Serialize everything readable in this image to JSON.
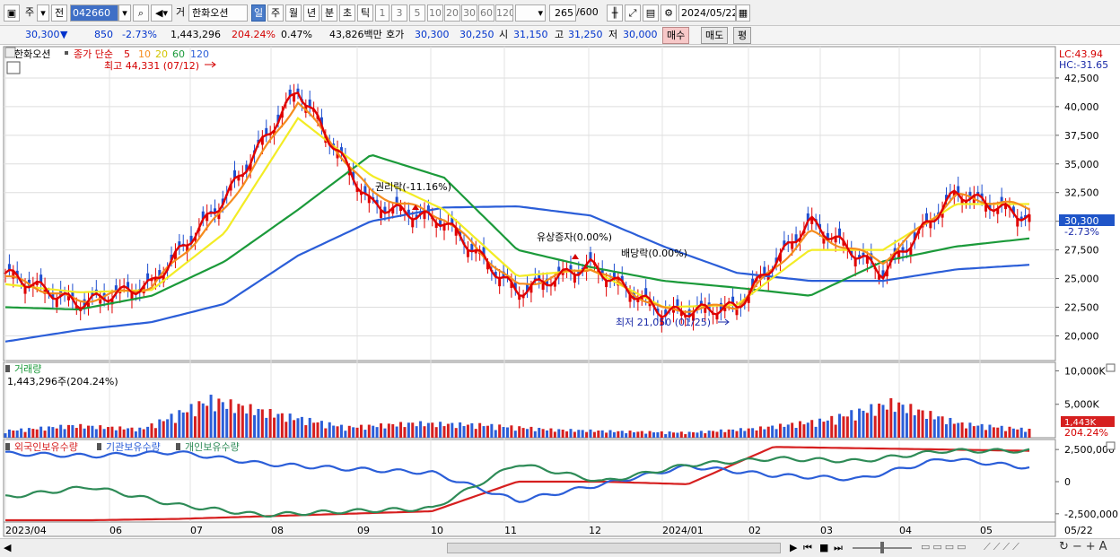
{
  "toolbar": {
    "market_label": "주",
    "prev_label": "전",
    "stock_code": "042660",
    "stock_name_prefix": "거",
    "stock_name": "한화오션",
    "period_tabs": [
      "일",
      "주",
      "월",
      "년",
      "분",
      "초",
      "틱"
    ],
    "active_period": "일",
    "interval_buttons": [
      "1",
      "3",
      "5",
      "10",
      "20",
      "30",
      "60",
      "120"
    ],
    "count_value": "265",
    "count_total": "/600",
    "date_value": "2024/05/22"
  },
  "info": {
    "price": "30,300",
    "change": "850",
    "change_pct": "-2.73%",
    "volume": "1,443,296",
    "volume_ratio": "204.24%",
    "turnover_pct": "0.47%",
    "amount": "43,826백만",
    "ask_label": "호가",
    "ask_price": "30,300",
    "bid_price": "30,250",
    "open_label": "시",
    "open_price": "31,150",
    "high_label": "고",
    "high_price": "31,250",
    "low_label": "저",
    "low_price": "30,000",
    "buy_label": "매수",
    "sell_label": "매도",
    "eval_label": "평"
  },
  "legend": {
    "stock_name": "한화오션",
    "ma_label": "종가 단순",
    "ma_periods": [
      "5",
      "10",
      "20",
      "60",
      "120"
    ],
    "ma_colors": [
      "#e00000",
      "#f58c1e",
      "#f3ec25",
      "#1b9a3a",
      "#2b5ed8"
    ]
  },
  "price_panel": {
    "lc_label": "LC:43.94",
    "hc_label": "HC:-31.65",
    "current_price_label": "30,300",
    "current_change_label": "-2.73%",
    "high_annotation": "최고 44,331 (07/12)",
    "low_annotation": "최저 21,050 (01/25)",
    "events": [
      "권리락(-11.16%)",
      "유상증자(0.00%)",
      "배당락(0.00%)"
    ]
  },
  "volume_panel": {
    "title": "거래량",
    "value_label": "1,443,296주(204.24%)",
    "current_label": "1,443K",
    "current_pct_label": "204.24%"
  },
  "holdings_panel": {
    "series_labels": [
      "외국인보유수량",
      "기관보유수량",
      "개인보유수량"
    ],
    "series_colors": [
      "#d61f1f",
      "#2b5ed8",
      "#2e8b57"
    ]
  },
  "x_axis_labels": [
    "2023/04",
    "06",
    "07",
    "08",
    "09",
    "10",
    "11",
    "12",
    "2024/01",
    "02",
    "03",
    "04",
    "05",
    "05/22"
  ],
  "chart_data": [
    {
      "type": "line",
      "title": "",
      "y_ticks": [
        20000,
        22500,
        25000,
        27500,
        30000,
        32500,
        35000,
        37500,
        40000,
        42500
      ],
      "y_tick_labels": [
        "20,000",
        "22,500",
        "25,000",
        "27,500",
        "30,000",
        "32,500",
        "35,000",
        "37,500",
        "40,000",
        "42,500"
      ],
      "ylim": [
        18000,
        45000
      ],
      "x": [
        "2023/04",
        "05",
        "06",
        "07",
        "08",
        "09",
        "10",
        "11",
        "12",
        "2024/01",
        "02",
        "03",
        "04",
        "05",
        "05/22"
      ],
      "series": [
        {
          "name": "5",
          "values": [
            25500,
            22800,
            24500,
            32000,
            41500,
            31500,
            30000,
            23800,
            26200,
            22000,
            22500,
            30000,
            25500,
            32500,
            30300
          ]
        },
        {
          "name": "10",
          "values": [
            25200,
            23000,
            24300,
            31000,
            40500,
            32500,
            30300,
            24300,
            26000,
            22200,
            22600,
            29000,
            26500,
            32200,
            31200
          ]
        },
        {
          "name": "20",
          "values": [
            24500,
            23800,
            24000,
            29000,
            39000,
            34000,
            31000,
            25200,
            25800,
            22500,
            22700,
            27500,
            27500,
            31500,
            31500
          ]
        },
        {
          "name": "60",
          "values": [
            22500,
            22300,
            23500,
            26500,
            31000,
            35800,
            33800,
            27500,
            26000,
            24800,
            24200,
            23500,
            26500,
            27800,
            28500
          ]
        },
        {
          "name": "120",
          "values": [
            19500,
            20500,
            21200,
            22800,
            27000,
            30000,
            31200,
            31300,
            30500,
            27800,
            25500,
            24800,
            24800,
            25800,
            26200
          ]
        }
      ]
    },
    {
      "type": "bar",
      "title": "",
      "y_tick_labels": [
        "5,000K",
        "10,000K"
      ],
      "ylim": [
        0,
        11000
      ],
      "values_k": [
        1200,
        2100,
        1500,
        6500,
        4000,
        1800,
        2500,
        2200,
        1400,
        1100,
        900,
        1600,
        3000,
        6000,
        2400,
        1400
      ]
    },
    {
      "type": "line",
      "title": "",
      "y_tick_labels": [
        "2,500,000",
        "0",
        "-2,500,000"
      ],
      "ylim": [
        -3000000,
        3000000
      ],
      "series": [
        {
          "name": "외국인보유수량",
          "values": [
            -3000000,
            -3000000,
            -2900000,
            -2700000,
            -2500000,
            -2300000,
            0,
            0,
            -200000,
            2700000,
            2600000,
            2500000,
            2400000
          ]
        },
        {
          "name": "기관보유수량",
          "values": [
            2200000,
            2000000,
            2300000,
            1400000,
            1000000,
            700000,
            -1500000,
            -200000,
            1200000,
            500000,
            200000,
            1800000,
            1100000
          ]
        },
        {
          "name": "개인보유수량",
          "values": [
            -1200000,
            -400000,
            -1800000,
            -2600000,
            -2300000,
            -2100000,
            1400000,
            0,
            1300000,
            1800000,
            1600000,
            2400000,
            2400000
          ]
        }
      ]
    }
  ]
}
